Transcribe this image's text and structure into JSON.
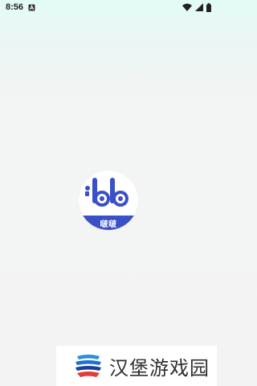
{
  "status_bar": {
    "time": "8:56",
    "icons": [
      "notification-a-icon",
      "wifi-icon",
      "signal-icon",
      "battery-icon"
    ]
  },
  "splash": {
    "logo_label": "啵啵",
    "accent_color": "#3b50c6"
  },
  "watermark": {
    "text": "汉堡游戏园"
  }
}
